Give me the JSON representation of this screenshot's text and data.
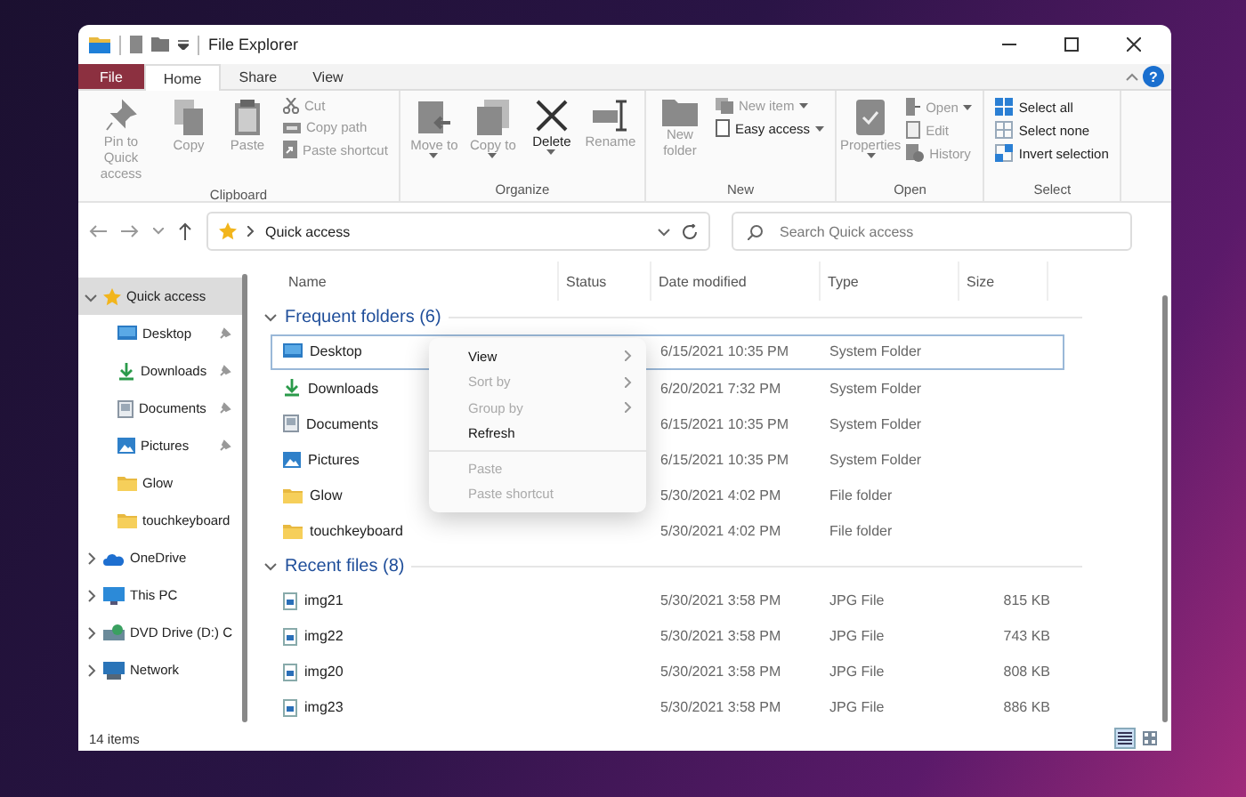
{
  "window": {
    "title": "File Explorer"
  },
  "ribbon_tabs": [
    {
      "label": "File",
      "kind": "file",
      "selected": false
    },
    {
      "label": "Home",
      "kind": "tab",
      "selected": true
    },
    {
      "label": "Share",
      "kind": "tab",
      "selected": false
    },
    {
      "label": "View",
      "kind": "tab",
      "selected": false
    }
  ],
  "help": {
    "glyph": "?"
  },
  "ribbon_groups": [
    {
      "label": "Clipboard",
      "buttons": [
        {
          "label": "Pin to Quick access",
          "kind": "large",
          "disabled": true,
          "dropdown": false
        },
        {
          "label": "Copy",
          "kind": "large",
          "disabled": true,
          "dropdown": false
        },
        {
          "label": "Paste",
          "kind": "large",
          "disabled": true,
          "dropdown": false
        },
        {
          "label": "Cut",
          "kind": "small",
          "disabled": true,
          "dropdown": false
        },
        {
          "label": "Copy path",
          "kind": "small",
          "disabled": true,
          "dropdown": false
        },
        {
          "label": "Paste shortcut",
          "kind": "small",
          "disabled": true,
          "dropdown": false
        }
      ]
    },
    {
      "label": "Organize",
      "buttons": [
        {
          "label": "Move to",
          "kind": "large",
          "disabled": true,
          "dropdown": true
        },
        {
          "label": "Copy to",
          "kind": "large",
          "disabled": true,
          "dropdown": true
        },
        {
          "label": "Delete",
          "kind": "large",
          "disabled": false,
          "dropdown": true
        },
        {
          "label": "Rename",
          "kind": "large",
          "disabled": true,
          "dropdown": false
        }
      ]
    },
    {
      "label": "New",
      "buttons": [
        {
          "label": "New folder",
          "kind": "large",
          "disabled": true,
          "dropdown": false
        },
        {
          "label": "New item",
          "kind": "small",
          "disabled": true,
          "dropdown": true
        },
        {
          "label": "Easy access",
          "kind": "small",
          "disabled": false,
          "dropdown": true
        }
      ]
    },
    {
      "label": "Open",
      "buttons": [
        {
          "label": "Properties",
          "kind": "large",
          "disabled": true,
          "dropdown": true
        },
        {
          "label": "Open",
          "kind": "small",
          "disabled": true,
          "dropdown": true
        },
        {
          "label": "Edit",
          "kind": "small",
          "disabled": true,
          "dropdown": false
        },
        {
          "label": "History",
          "kind": "small",
          "disabled": true,
          "dropdown": false
        }
      ]
    },
    {
      "label": "Select",
      "buttons": [
        {
          "label": "Select all",
          "kind": "small",
          "disabled": false,
          "dropdown": false
        },
        {
          "label": "Select none",
          "kind": "small",
          "disabled": false,
          "dropdown": false
        },
        {
          "label": "Invert selection",
          "kind": "small",
          "disabled": false,
          "dropdown": false
        }
      ]
    }
  ],
  "address": {
    "location": "Quick access"
  },
  "search": {
    "placeholder": "Search Quick access"
  },
  "navigation": [
    {
      "label": "Quick access",
      "expanded": true,
      "selected": true,
      "children": [
        {
          "label": "Desktop",
          "pinned": true,
          "selected": false
        },
        {
          "label": "Downloads",
          "pinned": true,
          "selected": false
        },
        {
          "label": "Documents",
          "pinned": true,
          "selected": false
        },
        {
          "label": "Pictures",
          "pinned": true,
          "selected": false
        },
        {
          "label": "Glow",
          "pinned": false,
          "selected": false
        },
        {
          "label": "touchkeyboard",
          "pinned": false,
          "selected": false
        }
      ]
    },
    {
      "label": "OneDrive",
      "expanded": false,
      "selected": false
    },
    {
      "label": "This PC",
      "expanded": false,
      "selected": false
    },
    {
      "label": "DVD Drive (D:) C",
      "expanded": false,
      "selected": false
    },
    {
      "label": "Network",
      "expanded": false,
      "selected": false
    }
  ],
  "columns": [
    "Name",
    "Status",
    "Date modified",
    "Type",
    "Size"
  ],
  "groups": [
    {
      "label": "Frequent folders (6)",
      "expanded": true,
      "rows": [
        {
          "name": "Desktop",
          "date": "6/15/2021 10:35 PM",
          "type": "System Folder",
          "selected": true
        },
        {
          "name": "Downloads",
          "date": "6/20/2021 7:32 PM",
          "type": "System Folder",
          "selected": false
        },
        {
          "name": "Documents",
          "date": "6/15/2021 10:35 PM",
          "type": "System Folder",
          "selected": false
        },
        {
          "name": "Pictures",
          "date": "6/15/2021 10:35 PM",
          "type": "System Folder",
          "selected": false
        },
        {
          "name": "Glow",
          "date": "5/30/2021 4:02 PM",
          "type": "File folder",
          "selected": false
        },
        {
          "name": "touchkeyboard",
          "date": "5/30/2021 4:02 PM",
          "type": "File folder",
          "selected": false
        }
      ]
    },
    {
      "label": "Recent files (8)",
      "expanded": true,
      "rows": [
        {
          "name": "img21",
          "date": "5/30/2021 3:58 PM",
          "type": "JPG File",
          "size": "815 KB",
          "selected": false
        },
        {
          "name": "img22",
          "date": "5/30/2021 3:58 PM",
          "type": "JPG File",
          "size": "743 KB",
          "selected": false
        },
        {
          "name": "img20",
          "date": "5/30/2021 3:58 PM",
          "type": "JPG File",
          "size": "808 KB",
          "selected": false
        },
        {
          "name": "img23",
          "date": "5/30/2021 3:58 PM",
          "type": "JPG File",
          "size": "886 KB",
          "selected": false
        }
      ]
    }
  ],
  "context_menu": {
    "sections": [
      [
        {
          "label": "View",
          "disabled": false,
          "submenu": true
        },
        {
          "label": "Sort by",
          "disabled": true,
          "submenu": true
        },
        {
          "label": "Group by",
          "disabled": true,
          "submenu": true
        },
        {
          "label": "Refresh",
          "disabled": false,
          "submenu": false
        }
      ],
      [
        {
          "label": "Paste",
          "disabled": true,
          "submenu": false
        },
        {
          "label": "Paste shortcut",
          "disabled": true,
          "submenu": false
        }
      ]
    ]
  },
  "status_bar": {
    "text": "14 items"
  },
  "view_buttons": [
    {
      "selected": true
    },
    {
      "selected": false
    }
  ]
}
